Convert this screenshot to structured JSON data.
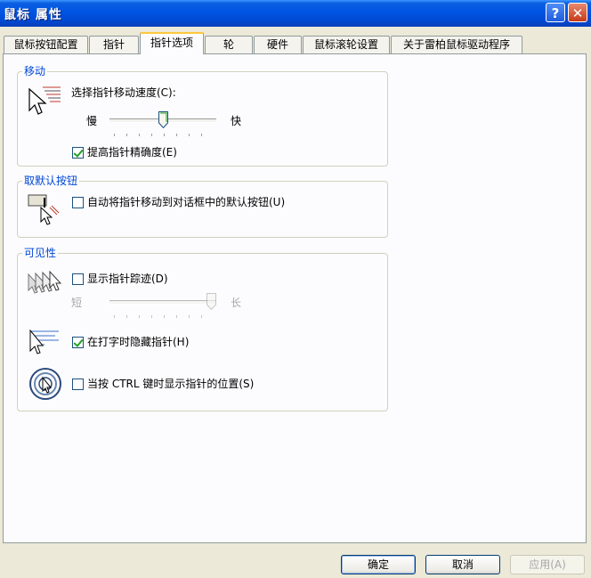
{
  "window": {
    "title": "鼠标 属性",
    "help_glyph": "?",
    "close_glyph": "✕"
  },
  "tabs": [
    {
      "label": "鼠标按钮配置"
    },
    {
      "label": "指针"
    },
    {
      "label": "指针选项"
    },
    {
      "label": "轮"
    },
    {
      "label": "硬件"
    },
    {
      "label": "鼠标滚轮设置"
    },
    {
      "label": "关于雷柏鼠标驱动程序"
    }
  ],
  "motion": {
    "legend": "移动",
    "speed_label": "选择指针移动速度(C):",
    "slow": "慢",
    "fast": "快",
    "speed_level": 0.5,
    "precision_label": "提高指针精确度(E)",
    "precision_checked": true
  },
  "snap": {
    "legend": "取默认按钮",
    "snap_label": "自动将指针移动到对话框中的默认按钮(U)",
    "snap_checked": false
  },
  "visibility": {
    "legend": "可见性",
    "trails_label": "显示指针踪迹(D)",
    "trails_checked": false,
    "short": "短",
    "long": "长",
    "trails_level": 1.0,
    "hide_label": "在打字时隐藏指针(H)",
    "hide_checked": true,
    "ctrl_label": "当按 CTRL 键时显示指针的位置(S)",
    "ctrl_checked": false
  },
  "buttons": {
    "ok": "确定",
    "cancel": "取消",
    "apply": "应用(A)"
  },
  "colors": {
    "accent": "#0046d5",
    "titlebar": "#0054e3",
    "tab_highlight": "#ffc83c"
  }
}
